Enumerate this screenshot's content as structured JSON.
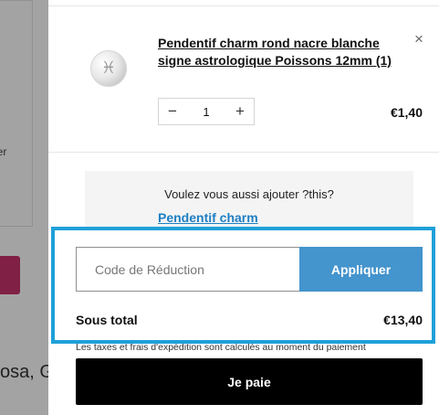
{
  "background": {
    "card_text": "ier",
    "pink_button_label": "",
    "bottom_text": "osa, G"
  },
  "cart": {
    "item": {
      "title": "Pendentif charm rond nacre blanche signe astrologique Poissons 12mm (1)",
      "image_icon": "pisces-symbol",
      "image_glyph": "♓",
      "remove_icon": "close-icon",
      "remove_glyph": "×",
      "quantity": "1",
      "minus_glyph": "−",
      "plus_glyph": "+",
      "price": "€1,40"
    },
    "upsell": {
      "prompt": "Voulez vous aussi ajouter ?this?",
      "link_label": "Pendentif charm"
    },
    "footer": {
      "promo_placeholder": "Code de Réduction",
      "apply_label": "Appliquer",
      "subtotal_label": "Sous total",
      "subtotal_value": "€13,40",
      "tax_note": "Les taxes et frais d'expédition sont calculés au moment du paiement",
      "pay_label": "Je paie"
    }
  },
  "colors": {
    "apply_button": "#4494cd",
    "pay_button": "#000000",
    "link": "#1e7fc3",
    "highlight": "#1fa0d8",
    "pink_button": "#c8326b"
  }
}
